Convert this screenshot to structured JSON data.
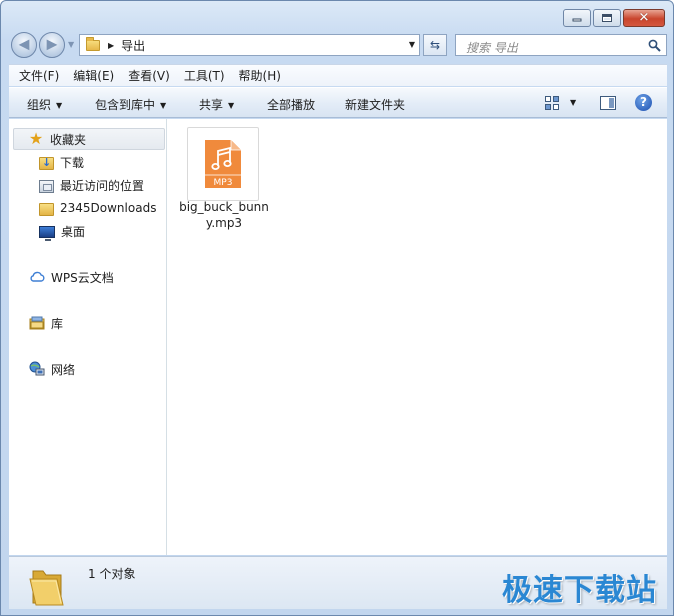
{
  "window": {
    "caption_buttons": [
      "minimize",
      "maximize",
      "close"
    ]
  },
  "navigation": {
    "back_icon": "back-arrow-icon",
    "forward_icon": "forward-arrow-icon",
    "breadcrumb": [
      "导出"
    ],
    "search_placeholder": "搜索 导出"
  },
  "menubar": {
    "items": [
      "文件(F)",
      "编辑(E)",
      "查看(V)",
      "工具(T)",
      "帮助(H)"
    ]
  },
  "commandbar": {
    "organize": "组织",
    "include_in_library": "包含到库中",
    "share": "共享",
    "play_all": "全部播放",
    "new_folder": "新建文件夹"
  },
  "sidebar": {
    "favorites": {
      "label": "收藏夹",
      "items": [
        {
          "label": "下载",
          "icon": "downloads-folder-icon"
        },
        {
          "label": "最近访问的位置",
          "icon": "recent-places-icon"
        },
        {
          "label": "2345Downloads",
          "icon": "folder-icon"
        },
        {
          "label": "桌面",
          "icon": "desktop-icon"
        }
      ]
    },
    "wps": {
      "label": "WPS云文档",
      "icon": "cloud-icon"
    },
    "library": {
      "label": "库",
      "icon": "library-icon"
    },
    "network": {
      "label": "网络",
      "icon": "network-icon"
    }
  },
  "files": [
    {
      "name": "big_buck_bunny.mp3",
      "badge": "MP3",
      "icon": "mp3-file-icon"
    }
  ],
  "status": {
    "text": "1 个对象"
  },
  "watermark": "极速下载站",
  "colors": {
    "mp3_orange": "#f08a3c",
    "watermark_blue": "#2a87d3",
    "chrome_blue": "#c7daf1"
  }
}
